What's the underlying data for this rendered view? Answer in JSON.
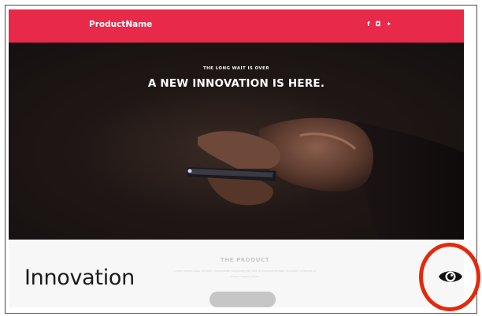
{
  "nav": {
    "brand": "ProductName",
    "social_icons": [
      {
        "name": "facebook-icon",
        "glyph": "f"
      },
      {
        "name": "instagram-icon",
        "glyph": "◘"
      },
      {
        "name": "twitter-icon",
        "glyph": "✦"
      }
    ]
  },
  "hero": {
    "kicker": "THE LONG WAIT IS OVER",
    "title": "A NEW INNOVATION IS HERE."
  },
  "product": {
    "heading": "THE PRODUCT",
    "description": "Lorem ipsum dolor sit amet, consectetur adipiscing elit, sed do eiusmod tempor incididunt ut labore et dolore magna aliqua."
  },
  "overlay": {
    "label": "Innovation",
    "preview_icon": "eye-icon"
  },
  "colors": {
    "brand": "#e8294a",
    "highlight_ring": "#e4290b"
  }
}
